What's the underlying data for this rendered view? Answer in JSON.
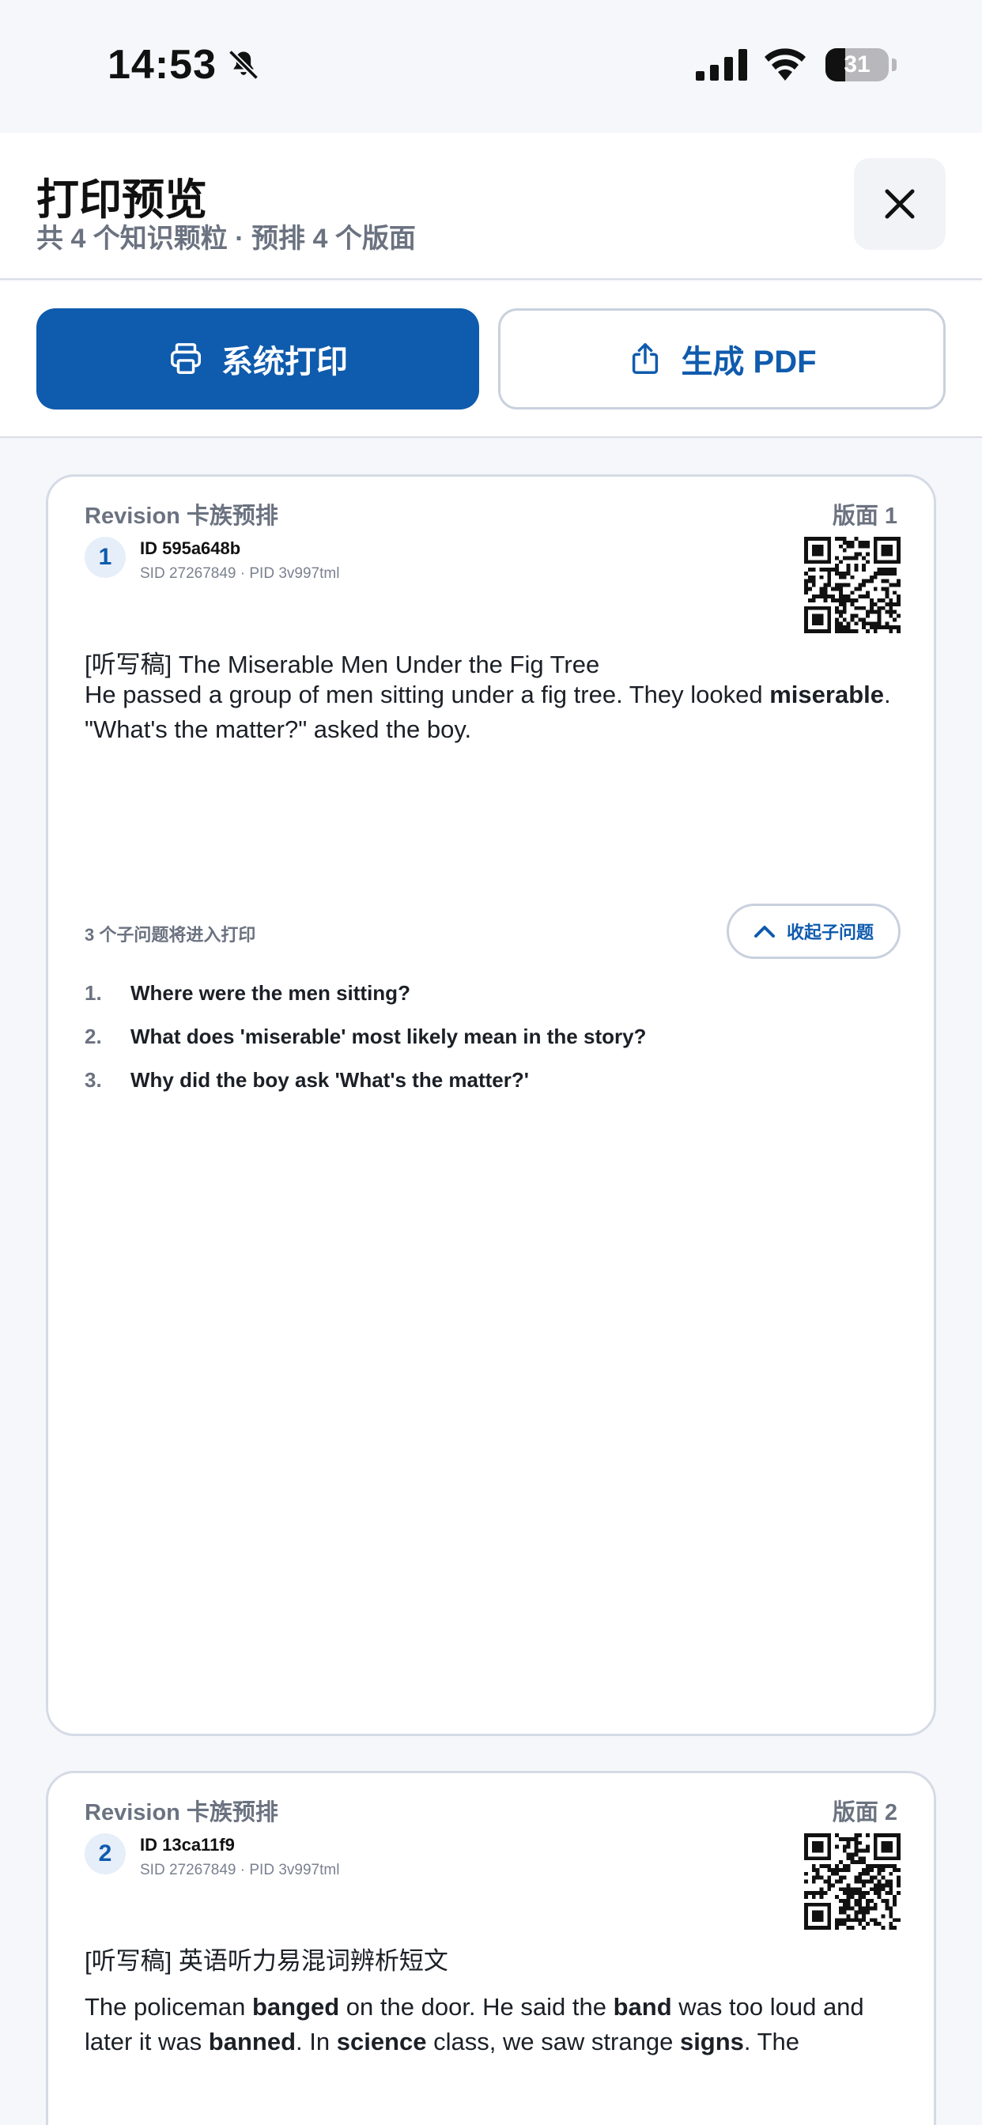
{
  "status_bar": {
    "time": "14:53",
    "battery": "31"
  },
  "header": {
    "title": "打印预览",
    "subtitle": "共 4 个知识颗粒 · 预排 4 个版面"
  },
  "actions": {
    "print_label": "系统打印",
    "pdf_label": "生成 PDF"
  },
  "cards": [
    {
      "kicker": "Revision 卡族预排",
      "page_label": "版面 1",
      "number": "1",
      "id_line": "ID 595a648b",
      "meta_line": "SID 27267849 · PID 3v997tml",
      "title": "[听写稿] The Miserable Men Under the Fig Tree",
      "body_1": "He passed a group of men sitting under a fig tree. They looked ",
      "body_bold": "miserable",
      "body_2": ". \"What's the matter?\" asked the boy.",
      "subq_count": "3 个子问题将进入打印",
      "collapse_label": "收起子问题",
      "subquestions": [
        {
          "n": "1.",
          "text": "Where were the men sitting?"
        },
        {
          "n": "2.",
          "text": "What does 'miserable' most likely mean in the story?"
        },
        {
          "n": "3.",
          "text": "Why did the boy ask 'What's the matter?'"
        }
      ]
    },
    {
      "kicker": "Revision 卡族预排",
      "page_label": "版面 2",
      "number": "2",
      "id_line": "ID 13ca11f9",
      "meta_line": "SID 27267849 · PID 3v997tml",
      "title": "[听写稿] 英语听力易混词辨析短文",
      "body_parts": [
        {
          "t": "The policeman ",
          "b": false
        },
        {
          "t": "banged",
          "b": true
        },
        {
          "t": " on the door. He said the ",
          "b": false
        },
        {
          "t": "band",
          "b": true
        },
        {
          "t": " was too loud and later it was ",
          "b": false
        },
        {
          "t": "banned",
          "b": true
        },
        {
          "t": ". In ",
          "b": false
        },
        {
          "t": "science",
          "b": true
        },
        {
          "t": " class, we saw strange ",
          "b": false
        },
        {
          "t": "signs",
          "b": true
        },
        {
          "t": ". The",
          "b": false
        }
      ]
    }
  ]
}
